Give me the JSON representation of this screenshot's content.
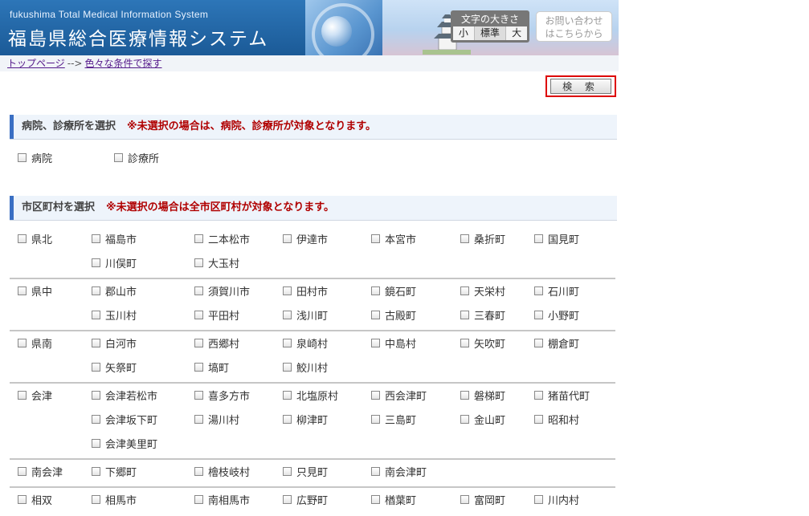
{
  "header": {
    "title_en": "fukushima Total Medical Information System",
    "title_jp": "福島県総合医療情報システム",
    "font_size": {
      "title": "文字の大きさ",
      "small": "小",
      "standard": "標準",
      "large": "大"
    },
    "contact_line1": "お問い合わせ",
    "contact_line2": "はこちらから"
  },
  "breadcrumb": {
    "home": "トップページ",
    "arrow": "-->",
    "current": "色々な条件で探す"
  },
  "search_button": "検 索",
  "facility_section": {
    "title": "病院、診療所を選択",
    "note": "※未選択の場合は、病院、診療所が対象となります。",
    "options": [
      "病院",
      "診療所"
    ]
  },
  "area_section": {
    "title": "市区町村を選択",
    "note": "※未選択の場合は全市区町村が対象となります。",
    "regions": [
      {
        "name": "県北",
        "towns": [
          "福島市",
          "二本松市",
          "伊達市",
          "本宮市",
          "桑折町",
          "国見町",
          "川俣町",
          "大玉村"
        ]
      },
      {
        "name": "県中",
        "towns": [
          "郡山市",
          "須賀川市",
          "田村市",
          "鏡石町",
          "天栄村",
          "石川町",
          "玉川村",
          "平田村",
          "浅川町",
          "古殿町",
          "三春町",
          "小野町"
        ]
      },
      {
        "name": "県南",
        "towns": [
          "白河市",
          "西郷村",
          "泉崎村",
          "中島村",
          "矢吹町",
          "棚倉町",
          "矢祭町",
          "塙町",
          "鮫川村"
        ]
      },
      {
        "name": "会津",
        "towns": [
          "会津若松市",
          "喜多方市",
          "北塩原村",
          "西会津町",
          "磐梯町",
          "猪苗代町",
          "会津坂下町",
          "湯川村",
          "柳津町",
          "三島町",
          "金山町",
          "昭和村",
          "会津美里町"
        ]
      },
      {
        "name": "南会津",
        "towns": [
          "下郷町",
          "檜枝岐村",
          "只見町",
          "南会津町"
        ]
      },
      {
        "name": "相双",
        "towns": [
          "相馬市",
          "南相馬市",
          "広野町",
          "楢葉町",
          "富岡町",
          "川内村"
        ]
      }
    ]
  }
}
